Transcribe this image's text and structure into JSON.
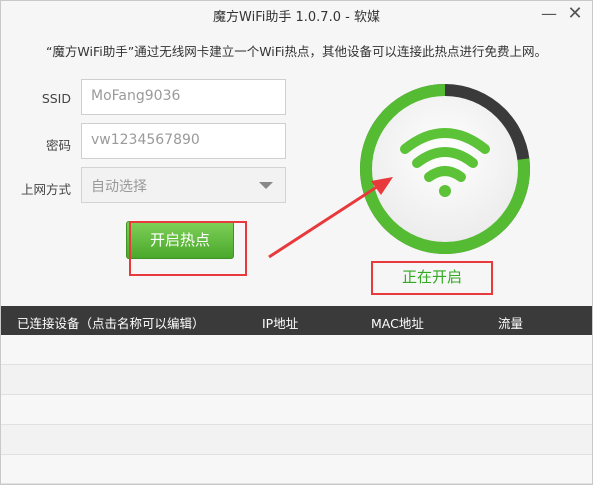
{
  "window": {
    "title": "魔方WiFi助手 1.0.7.0 - 软媒",
    "minimize_glyph": "—",
    "close_glyph": "✕"
  },
  "intro_text": "“魔方WiFi助手”通过无线网卡建立一个WiFi热点，其他设备可以连接此热点进行免费上网。",
  "form": {
    "ssid_label": "SSID",
    "ssid_value": "MoFang9036",
    "password_label": "密码",
    "password_value": "vw1234567890",
    "mode_label": "上网方式",
    "mode_value": "自动选择"
  },
  "start_button_label": "开启热点",
  "status_text": "正在开启",
  "progress_fraction": 0.23,
  "table": {
    "headers": [
      "已连接设备（点击名称可以编辑）",
      "IP地址",
      "MAC地址",
      "流量"
    ],
    "rows": []
  },
  "colors": {
    "accent_green": "#4caf2a",
    "wifi_green": "#5cc238",
    "annotation_red": "#e8393c",
    "header_dark": "#3a3a3a"
  },
  "icons": {
    "wifi": "wifi-icon",
    "dropdown": "chevron-down-icon"
  }
}
